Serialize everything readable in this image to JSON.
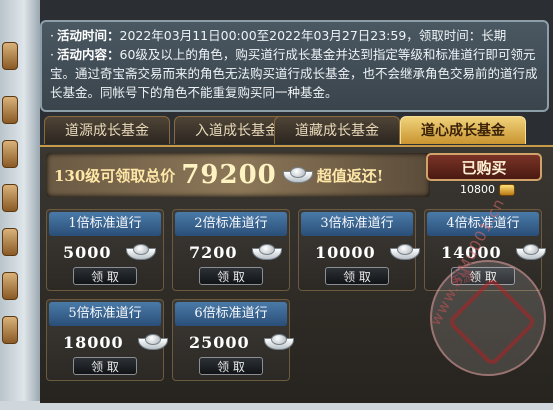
{
  "info": {
    "bullet": "·",
    "time_label": "活动时间：",
    "time_value": "2022年03月11日00:00至2022年03月27日23:59，领取时间：长期",
    "content_label": "活动内容：",
    "content_value": "60级及以上的角色，购买道行成长基金并达到指定等级和标准道行即可领元宝。通过奇宝斋交易而来的角色无法购买道行成长基金，也不会继承角色交易前的道行成长基金。同帐号下的角色不能重复购买同一种基金。"
  },
  "tabs": [
    {
      "label": "道源成长基金",
      "active": false
    },
    {
      "label": "入道成长基金",
      "active": false
    },
    {
      "label": "道藏成长基金",
      "active": false
    },
    {
      "label": "道心成长基金",
      "active": true
    }
  ],
  "banner": {
    "prefix": "130级可领取总价",
    "total": "79200",
    "suffix": "超值返还!"
  },
  "purchase": {
    "button_label": "已购买",
    "price": "10800"
  },
  "cards": [
    {
      "title": "1倍标准道行",
      "amount": "5000",
      "claim": "领 取"
    },
    {
      "title": "2倍标准道行",
      "amount": "7200",
      "claim": "领 取"
    },
    {
      "title": "3倍标准道行",
      "amount": "10000",
      "claim": "领 取"
    },
    {
      "title": "4倍标准道行",
      "amount": "14000",
      "claim": "领 取"
    },
    {
      "title": "5倍标准道行",
      "amount": "18000",
      "claim": "领 取"
    },
    {
      "title": "6倍标准道行",
      "amount": "25000",
      "claim": "领 取"
    }
  ],
  "watermark": {
    "top": "手游",
    "domain": "www.SiMu001.cn"
  },
  "colors": {
    "active_tab": "#e3b656",
    "card_header": "#3b679a",
    "banner_text": "#ffe7a8"
  }
}
